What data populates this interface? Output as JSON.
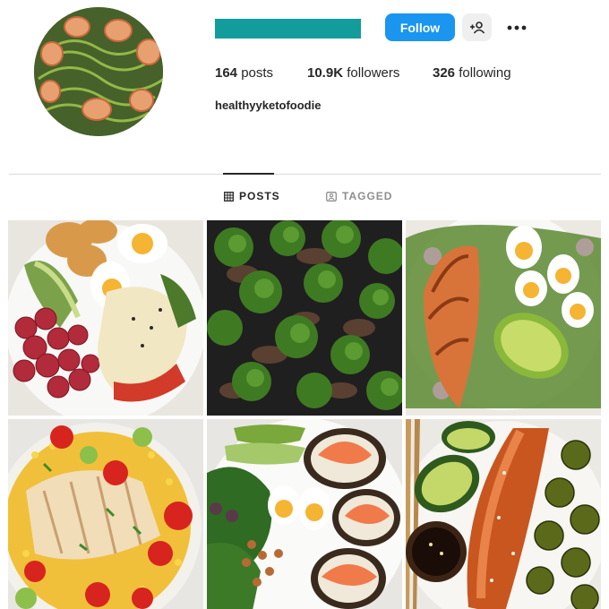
{
  "profile": {
    "username_redacted": true,
    "avatar_icon": "shrimp-zucchini-noodle-dish",
    "handle": "healthyyketofoodie"
  },
  "actions": {
    "follow_label": "Follow",
    "add_user_icon": "person-plus-icon",
    "more_icon": "ellipsis-icon"
  },
  "stats": {
    "posts_count": "164",
    "posts_label": "posts",
    "followers_count": "10.9K",
    "followers_label": "followers",
    "following_count": "326",
    "following_label": "following"
  },
  "tabs": {
    "posts_label": "POSTS",
    "tagged_label": "TAGGED",
    "active": "posts"
  },
  "colors": {
    "accent_follow": "#1a95f0",
    "redaction": "#139c9c"
  },
  "posts": [
    {
      "icon": "salad-grapes-eggs-croquettes"
    },
    {
      "icon": "broccoli-mushroom-stirfry"
    },
    {
      "icon": "grilled-chicken-avocado-eggs"
    },
    {
      "icon": "chicken-corn-tomato-salad"
    },
    {
      "icon": "smoked-salmon-eggs-avocado-chickpeas"
    },
    {
      "icon": "glazed-salmon-brussels-sprouts"
    }
  ]
}
